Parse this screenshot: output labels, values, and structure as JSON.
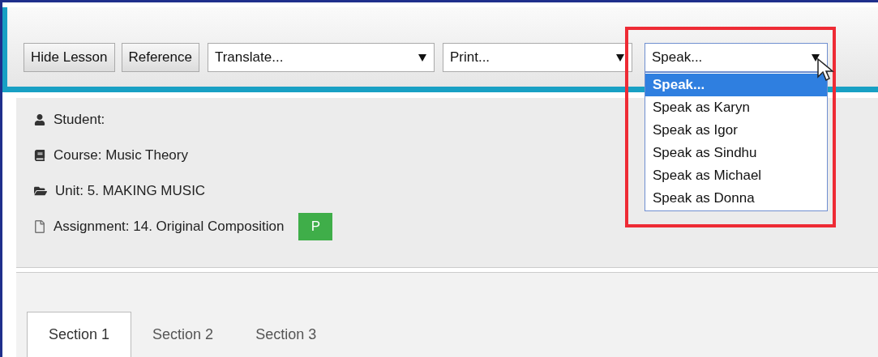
{
  "toolbar": {
    "buttons": [
      "Hide Lesson",
      "Reference"
    ],
    "selects": [
      {
        "value": "Translate...",
        "expanded": false,
        "highlighted": false
      },
      {
        "value": "Print...",
        "expanded": false,
        "highlighted": false
      },
      {
        "value": "Speak...",
        "expanded": true,
        "highlighted": true,
        "options": [
          {
            "label": "Speak...",
            "selected": true
          },
          {
            "label": "Speak as Karyn",
            "selected": false
          },
          {
            "label": "Speak as Igor",
            "selected": false
          },
          {
            "label": "Speak as Sindhu",
            "selected": false
          },
          {
            "label": "Speak as Michael",
            "selected": false
          },
          {
            "label": "Speak as Donna",
            "selected": false
          }
        ]
      }
    ]
  },
  "info": [
    {
      "kind": "student",
      "text": "Student:"
    },
    {
      "kind": "course",
      "text": "Course: Music Theory"
    },
    {
      "kind": "unit",
      "text": "Unit: 5. MAKING MUSIC"
    },
    {
      "kind": "assignment",
      "text": "Assignment: 14. Original Composition",
      "badge": {
        "text": "P",
        "color": "#3fae49"
      }
    }
  ],
  "tabs": [
    {
      "label": "Section 1",
      "selected": true
    },
    {
      "label": "Section 2",
      "selected": false
    },
    {
      "label": "Section 3",
      "selected": false
    }
  ]
}
